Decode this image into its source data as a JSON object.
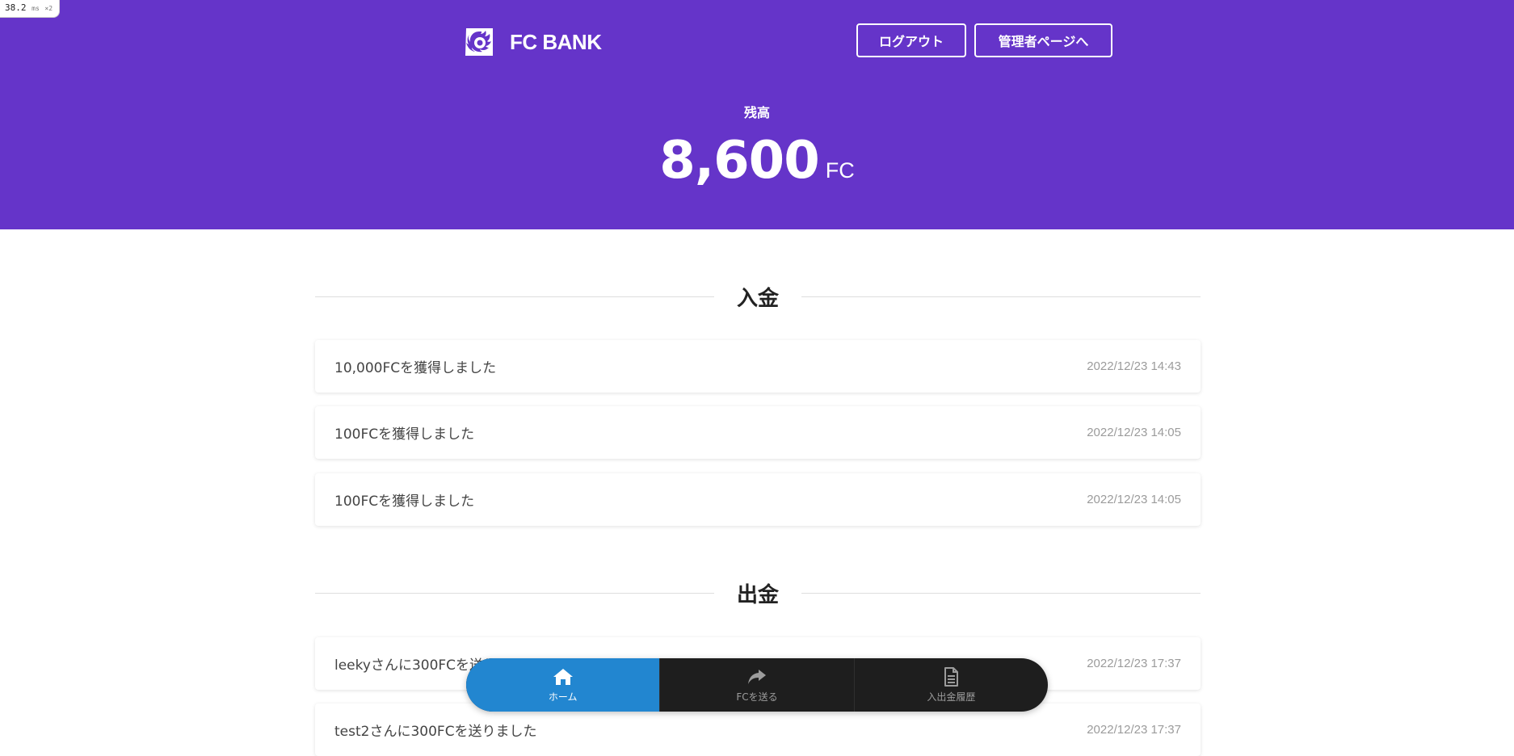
{
  "perf": {
    "value": "38.2",
    "unit": "ms",
    "mult": "×2"
  },
  "header": {
    "brand": "FC BANK",
    "logout_label": "ログアウト",
    "admin_label": "管理者ページへ",
    "bg_color": "#6534c9"
  },
  "balance": {
    "label": "残高",
    "amount": "8,600",
    "unit": "FC"
  },
  "deposits": {
    "title": "入金",
    "items": [
      {
        "text": "10,000FCを獲得しました",
        "date": "2022/12/23 14:43"
      },
      {
        "text": "100FCを獲得しました",
        "date": "2022/12/23 14:05"
      },
      {
        "text": "100FCを獲得しました",
        "date": "2022/12/23 14:05"
      }
    ]
  },
  "withdrawals": {
    "title": "出金",
    "items": [
      {
        "text": "leekyさんに300FCを送りました",
        "date": "2022/12/23 17:37"
      },
      {
        "text": "test2さんに300FCを送りました",
        "date": "2022/12/23 17:37"
      }
    ]
  },
  "nav": {
    "items": [
      {
        "label": "ホーム",
        "icon": "home-icon",
        "active": true
      },
      {
        "label": "FCを送る",
        "icon": "share-arrow-icon",
        "active": false
      },
      {
        "label": "入出金履歴",
        "icon": "document-icon",
        "active": false
      }
    ],
    "active_color": "#2286d0"
  }
}
